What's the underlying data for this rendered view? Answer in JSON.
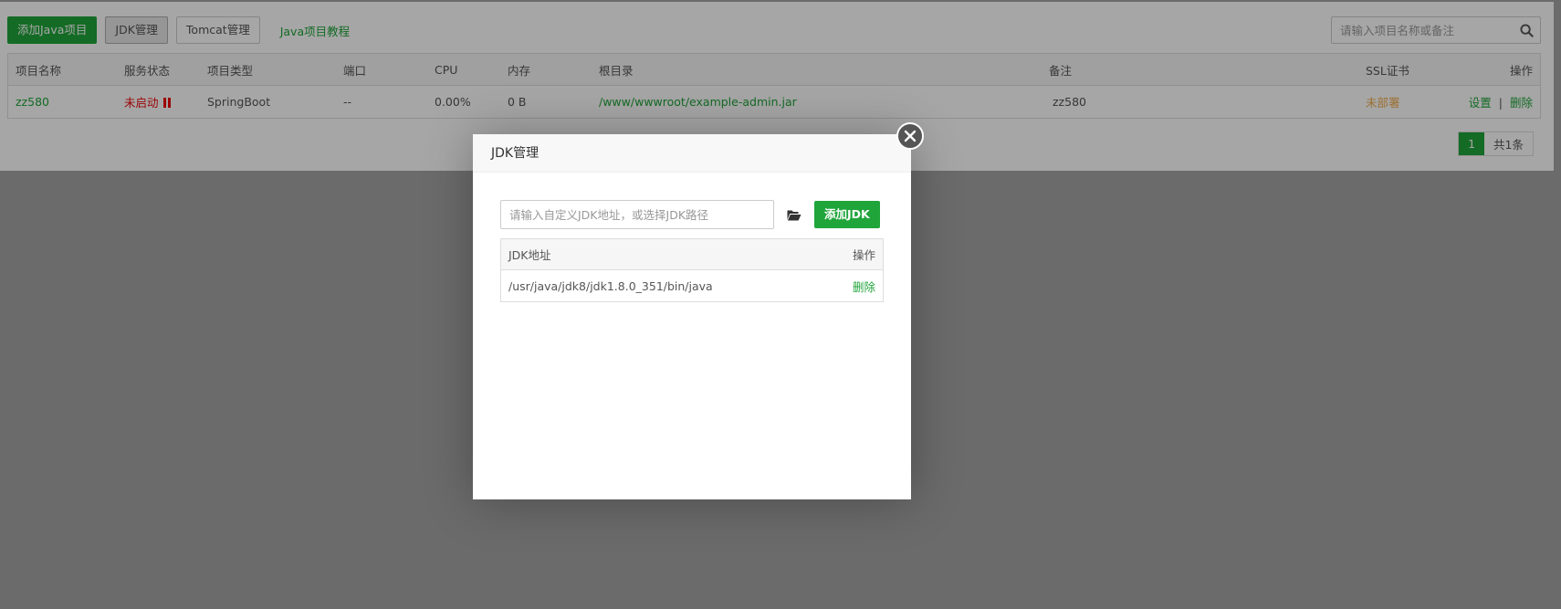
{
  "toolbar": {
    "add_java_project": "添加Java项目",
    "jdk_manage": "JDK管理",
    "tomcat_manage": "Tomcat管理",
    "java_tutorial": "Java项目教程"
  },
  "search": {
    "placeholder": "请输入项目名称或备注",
    "icon": "search-icon"
  },
  "table": {
    "headers": [
      "项目名称",
      "服务状态",
      "项目类型",
      "端口",
      "CPU",
      "内存",
      "根目录",
      "备注",
      "SSL证书",
      "操作"
    ],
    "rows": [
      {
        "name": "zz580",
        "status": "未启动",
        "status_icon": "pause-icon",
        "type": "SpringBoot",
        "port": "--",
        "cpu": "0.00%",
        "memory": "0 B",
        "root": "/www/wwwroot/example-admin.jar",
        "remark": "zz580",
        "ssl": "未部署",
        "action_settings": "设置",
        "action_separator": "|",
        "action_delete": "删除"
      }
    ]
  },
  "pager": {
    "current": "1",
    "total": "共1条"
  },
  "modal": {
    "title": "JDK管理",
    "input_placeholder": "请输入自定义JDK地址，或选择JDK路径",
    "add_button": "添加JDK",
    "table_headers": {
      "path": "JDK地址",
      "action": "操作"
    },
    "rows": [
      {
        "path": "/usr/java/jdk8/jdk1.8.0_351/bin/java",
        "action": "删除"
      }
    ]
  },
  "colors": {
    "accent": "#20a53a",
    "danger": "#ef0808",
    "warning": "#f0ad4e"
  }
}
